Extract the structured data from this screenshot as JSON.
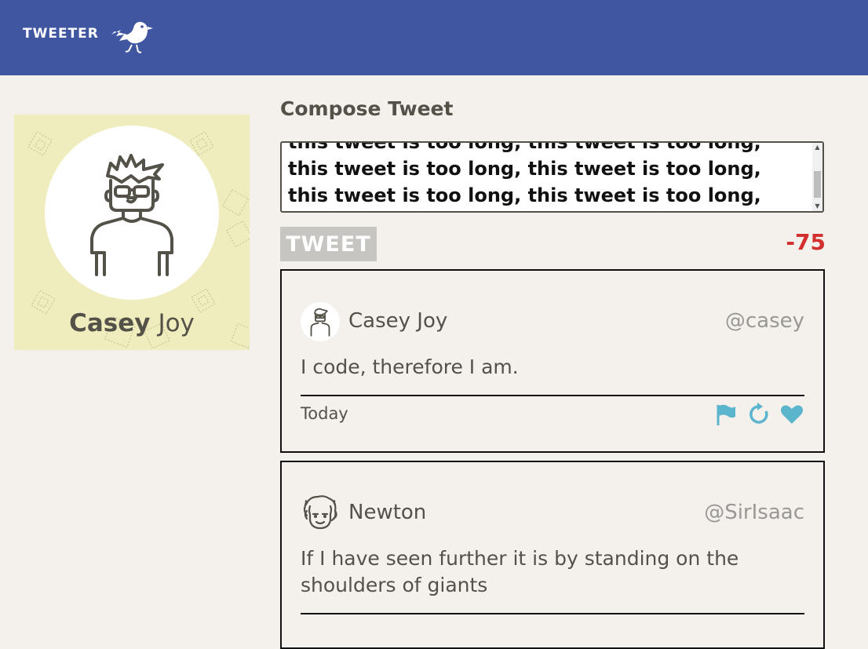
{
  "header": {
    "brand": "TWEETER",
    "logo_icon": "bird-icon",
    "colors": {
      "bar": "#4056a1",
      "text": "#ffffff"
    }
  },
  "profile": {
    "first_name": "Casey",
    "last_name": "Joy",
    "avatar_icon": "avatar-casey-icon",
    "background_color": "#efedbd"
  },
  "compose": {
    "title": "Compose Tweet",
    "text": "this tweet is too long, this tweet is too long, this tweet is too long, this tweet is too long, this tweet is too long, this tweet is too long, this tweet is too long.",
    "button_label": "TWEET",
    "counter": "-75",
    "counter_color": "#d32f2f"
  },
  "tweets": [
    {
      "name": "Casey Joy",
      "handle": "@casey",
      "body": "I code, therefore I am.",
      "date": "Today",
      "avatar_icon": "avatar-casey-icon",
      "actions": [
        "flag-icon",
        "retweet-icon",
        "heart-icon"
      ],
      "action_color": "#5bb5cc"
    },
    {
      "name": "Newton",
      "handle": "@SirIsaac",
      "body": "If I have seen further it is by standing on the shoulders of giants",
      "avatar_icon": "avatar-newton-icon"
    }
  ]
}
